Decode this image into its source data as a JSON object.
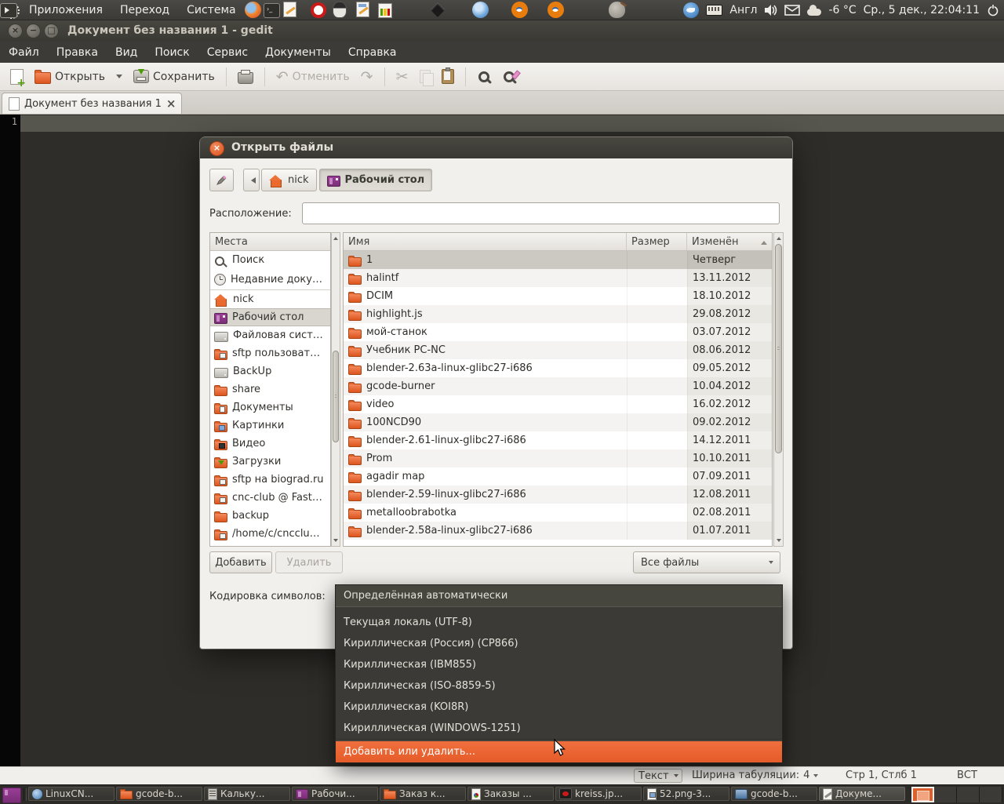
{
  "accent_color": "#E55B29",
  "top_panel": {
    "menus": [
      "Приложения",
      "Переход",
      "Система"
    ],
    "launchers": [
      {
        "icon": "firefox"
      },
      {
        "icon": "terminal"
      },
      {
        "icon": "text-editor"
      },
      {
        "icon": "opera"
      },
      {
        "icon": "penguin"
      },
      {
        "icon": "notes"
      },
      {
        "icon": "stats"
      },
      {
        "icon": "inkscape"
      },
      {
        "icon": "chromium"
      },
      {
        "icon": "blender"
      },
      {
        "icon": "blender"
      },
      {
        "icon": "gimp"
      },
      {
        "icon": "terminal-run"
      }
    ],
    "keyboard_layout": "Англ",
    "temperature": "-6 °C",
    "clock": "Ср., 5 дек., 22:04:11"
  },
  "window": {
    "title": "Документ без названия 1 - gedit",
    "menubar": [
      "Файл",
      "Правка",
      "Вид",
      "Поиск",
      "Сервис",
      "Документы",
      "Справка"
    ],
    "toolbar": {
      "open": "Открыть",
      "save": "Сохранить",
      "undo": "Отменить"
    },
    "tab_label": "Документ без названия 1",
    "editor_line_number": "1",
    "statusbar": {
      "highlight_mode": "Текст",
      "tab_width_label": "Ширина табуляции:",
      "tab_width_value": "4",
      "cursor_position": "Стр 1, Стлб 1",
      "insert_mode": "ВСТ"
    }
  },
  "dialog": {
    "title": "Открыть файлы",
    "path_buttons": [
      {
        "label": "nick",
        "icon": "home"
      },
      {
        "label": "Рабочий стол",
        "icon": "desktop",
        "active": true
      }
    ],
    "location_label": "Расположение:",
    "location_value": "",
    "places": {
      "header": "Места",
      "items": [
        {
          "label": "Поиск",
          "icon": "search"
        },
        {
          "label": "Недавние доку…",
          "icon": "recent",
          "separator_after": true
        },
        {
          "label": "nick",
          "icon": "home"
        },
        {
          "label": "Рабочий стол",
          "icon": "desktop",
          "selected": true
        },
        {
          "label": "Файловая сист…",
          "icon": "drive"
        },
        {
          "label": "sftp пользоват…",
          "icon": "folder-remote"
        },
        {
          "label": "BackUp",
          "icon": "drive"
        },
        {
          "label": "share",
          "icon": "folder"
        },
        {
          "label": "Документы",
          "icon": "folder-docs"
        },
        {
          "label": "Картинки",
          "icon": "folder-pics"
        },
        {
          "label": "Видео",
          "icon": "folder-video"
        },
        {
          "label": "Загрузки",
          "icon": "folder-down"
        },
        {
          "label": "sftp на biograd.ru",
          "icon": "folder-remote"
        },
        {
          "label": "cnc-club @ Fast…",
          "icon": "folder-remote"
        },
        {
          "label": "backup",
          "icon": "folder"
        },
        {
          "label": "/home/c/cncclu…",
          "icon": "folder-remote"
        }
      ]
    },
    "file_table": {
      "columns": {
        "name": "Имя",
        "size": "Размер",
        "modified": "Изменён"
      },
      "rows": [
        {
          "name": "1",
          "size": "",
          "modified": "Четверг",
          "icon": "folder",
          "selected": true
        },
        {
          "name": "halintf",
          "size": "",
          "modified": "13.11.2012",
          "icon": "folder"
        },
        {
          "name": "DCIM",
          "size": "",
          "modified": "18.10.2012",
          "icon": "folder"
        },
        {
          "name": "highlight.js",
          "size": "",
          "modified": "29.08.2012",
          "icon": "folder"
        },
        {
          "name": "мой-станок",
          "size": "",
          "modified": "03.07.2012",
          "icon": "folder"
        },
        {
          "name": "Учебник PC-NC",
          "size": "",
          "modified": "08.06.2012",
          "icon": "folder"
        },
        {
          "name": "blender-2.63a-linux-glibc27-i686",
          "size": "",
          "modified": "09.05.2012",
          "icon": "folder"
        },
        {
          "name": "gcode-burner",
          "size": "",
          "modified": "10.04.2012",
          "icon": "folder"
        },
        {
          "name": "video",
          "size": "",
          "modified": "16.02.2012",
          "icon": "folder"
        },
        {
          "name": "100NCD90",
          "size": "",
          "modified": "09.02.2012",
          "icon": "folder"
        },
        {
          "name": "blender-2.61-linux-glibc27-i686",
          "size": "",
          "modified": "14.12.2011",
          "icon": "folder"
        },
        {
          "name": "Prom",
          "size": "",
          "modified": "10.10.2011",
          "icon": "folder"
        },
        {
          "name": "agadir map",
          "size": "",
          "modified": "07.09.2011",
          "icon": "folder"
        },
        {
          "name": "blender-2.59-linux-glibc27-i686",
          "size": "",
          "modified": "12.08.2011",
          "icon": "folder"
        },
        {
          "name": "metalloobrabotka",
          "size": "",
          "modified": "02.08.2011",
          "icon": "folder"
        },
        {
          "name": "blender-2.58a-linux-glibc27-i686",
          "size": "",
          "modified": "01.07.2011",
          "icon": "folder"
        }
      ]
    },
    "add_button": "Добавить",
    "remove_button": "Удалить",
    "filter_value": "Все файлы",
    "encoding_label": "Кодировка символов:",
    "encoding_menu": {
      "items": [
        "Определённая автоматически",
        "Текущая локаль (UTF-8)",
        "Кириллическая (Россия) (CP866)",
        "Кириллическая (IBM855)",
        "Кириллическая (ISO-8859-5)",
        "Кириллическая (KOI8R)",
        "Кириллическая (WINDOWS-1251)"
      ],
      "action_item": "Добавить или удалить..."
    }
  },
  "taskbar": {
    "items": [
      {
        "label": "LinuxCN...",
        "icon": "globe"
      },
      {
        "label": "gcode-b...",
        "icon": "folder"
      },
      {
        "label": "Кальку...",
        "icon": "calc"
      },
      {
        "label": "Рабочи...",
        "icon": "desktop"
      },
      {
        "label": "Заказ к...",
        "icon": "folder"
      },
      {
        "label": "Заказы ...",
        "icon": "doc-chart"
      },
      {
        "label": "kreiss.jp...",
        "icon": "image-dark"
      },
      {
        "label": "52.png-3...",
        "icon": "image-page"
      },
      {
        "label": "gcode-b...",
        "icon": "app-blue"
      },
      {
        "label": "Докуме...",
        "icon": "gedit",
        "active": true
      }
    ],
    "workspaces": [
      {
        "active": true
      },
      {},
      {},
      {}
    ]
  }
}
